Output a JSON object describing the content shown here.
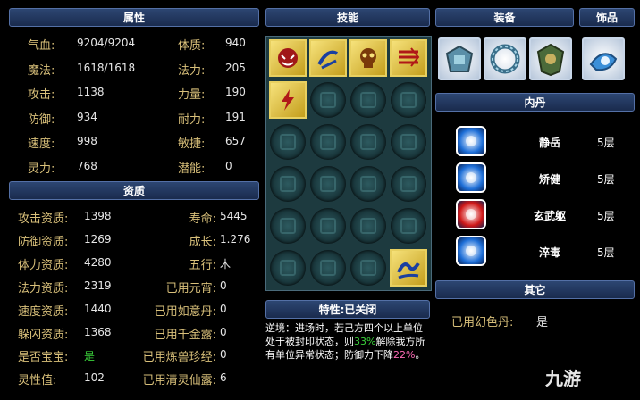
{
  "attributes": {
    "header": "属性",
    "rows": [
      {
        "l1": "气血:",
        "v1": "9204/9204",
        "l2": "体质:",
        "v2": "940"
      },
      {
        "l1": "魔法:",
        "v1": "1618/1618",
        "l2": "法力:",
        "v2": "205"
      },
      {
        "l1": "攻击:",
        "v1": "1138",
        "l2": "力量:",
        "v2": "190"
      },
      {
        "l1": "防御:",
        "v1": "934",
        "l2": "耐力:",
        "v2": "191"
      },
      {
        "l1": "速度:",
        "v1": "998",
        "l2": "敏捷:",
        "v2": "657"
      },
      {
        "l1": "灵力:",
        "v1": "768",
        "l2": "潜能:",
        "v2": "0"
      }
    ]
  },
  "aptitude": {
    "header": "资质",
    "rows": [
      {
        "l1": "攻击资质:",
        "v1": "1398",
        "l2": "寿命:",
        "v2": "5445"
      },
      {
        "l1": "防御资质:",
        "v1": "1269",
        "l2": "成长:",
        "v2": "1.276"
      },
      {
        "l1": "体力资质:",
        "v1": "4280",
        "l2": "五行:",
        "v2": "木"
      },
      {
        "l1": "法力资质:",
        "v1": "2319",
        "l2": "已用元宵:",
        "v2": "0"
      },
      {
        "l1": "速度资质:",
        "v1": "1440",
        "l2": "已用如意丹:",
        "v2": "0"
      },
      {
        "l1": "躲闪资质:",
        "v1": "1368",
        "l2": "已用千金露:",
        "v2": "0"
      },
      {
        "l1": "是否宝宝:",
        "v1": "是",
        "l2": "已用炼兽珍经:",
        "v2": "0"
      },
      {
        "l1": "灵性值:",
        "v1": "102",
        "l2": "已用清灵仙露:",
        "v2": "6"
      }
    ]
  },
  "skills": {
    "header": "技能",
    "icons": [
      "demon-skill-icon",
      "scroll-skill-icon",
      "skull-skill-icon",
      "charge-skill-icon",
      "lightning-skill-icon",
      "wave-skill-icon"
    ]
  },
  "trait": {
    "header": "特性:已关闭",
    "desc_a": "逆境：进场时，若己方四个以上单位处于被封印状态，则",
    "desc_pct1": "33%",
    "desc_b": "解除我方所有单位异常状态；防御力下降",
    "desc_pct2": "22%",
    "desc_c": "。"
  },
  "equipment": {
    "header": "装备",
    "accessory_header": "饰品",
    "items": [
      "armor-icon",
      "collar-icon",
      "shield-icon",
      "jewel-accessory-icon"
    ]
  },
  "inner_dan": {
    "header": "内丹",
    "items": [
      {
        "name": "静岳",
        "level": "5层",
        "color": "#1e6fd8"
      },
      {
        "name": "矫健",
        "level": "5层",
        "color": "#1e6fd8"
      },
      {
        "name": "玄武躯",
        "level": "5层",
        "color": "#d01818"
      },
      {
        "name": "淬毒",
        "level": "5层",
        "color": "#1e6fd8"
      }
    ]
  },
  "other": {
    "header": "其它",
    "label": "已用幻色丹:",
    "value": "是"
  },
  "watermark": "九游"
}
